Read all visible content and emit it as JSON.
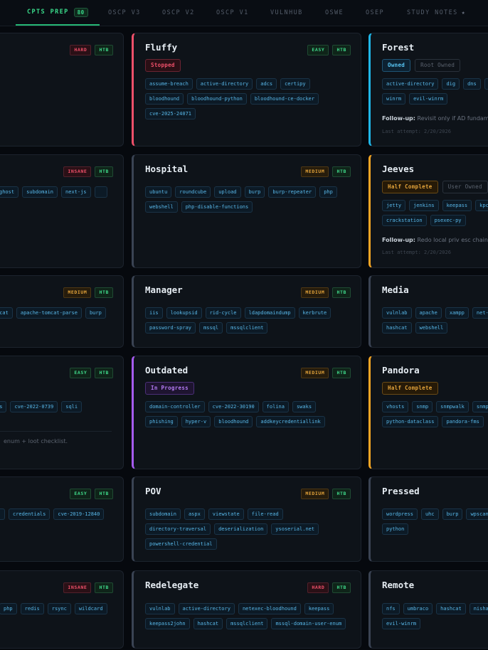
{
  "tabs": [
    {
      "label": "CPTS PREP",
      "count": "80",
      "active": true
    },
    {
      "label": "OSCP V3"
    },
    {
      "label": "OSCP V2"
    },
    {
      "label": "OSCP V1"
    },
    {
      "label": "VULNHUB"
    },
    {
      "label": "OSWE"
    },
    {
      "label": "OSEP"
    },
    {
      "label": "STUDY NOTES",
      "icon": "star-icon",
      "icon_glyph": "★"
    }
  ],
  "colors": {
    "accent_green": "#39d98a",
    "stopped_red": "#f0506a",
    "owned_blue": "#1fb6e8",
    "half_orange": "#f5a524",
    "progress_purple": "#a65bf0",
    "default_gray": "#3a4353"
  },
  "cards": {
    "r1c0": {
      "difficulty": "HARD",
      "platform": "HTB"
    },
    "r1c1": {
      "name": "Fluffy",
      "difficulty": "EASY",
      "platform": "HTB",
      "status": [
        "Stopped"
      ],
      "tags": [
        "assume-breach",
        "active-directory",
        "adcs",
        "certipy",
        "bloodhound",
        "bloodhound-python",
        "bloodhound-ce-docker",
        "cve-2025-24071"
      ]
    },
    "r1c2": {
      "name": "Forest",
      "status": [
        "Owned",
        "Root Owned"
      ],
      "tags": [
        "active-directory",
        "dig",
        "dns",
        "r",
        "winrm",
        "evil-winrm"
      ],
      "followup_label": "Follow-up:",
      "followup": "Revisit only if AD fundame",
      "last_attempt": "Last attempt: 2/20/2026"
    },
    "r2c0": {
      "difficulty": "INSANE",
      "platform": "HTB",
      "tags": [
        "ghost",
        "subdomain",
        "next-js",
        ""
      ]
    },
    "r2c1": {
      "name": "Hospital",
      "difficulty": "MEDIUM",
      "platform": "HTB",
      "tags": [
        "ubuntu",
        "roundcube",
        "upload",
        "burp",
        "burp-repeater",
        "php",
        "webshell",
        "php-disable-functions"
      ]
    },
    "r2c2": {
      "name": "Jeeves",
      "status": [
        "Half Complete",
        "User Owned"
      ],
      "tags": [
        "jetty",
        "jenkins",
        "keepass",
        "kpcl",
        "crackstation",
        "psexec-py"
      ],
      "followup_label": "Follow-up:",
      "followup": "Redo local priv esc chain s",
      "last_attempt": "Last attempt: 2/20/2026"
    },
    "r3c0": {
      "difficulty": "MEDIUM",
      "platform": "HTB",
      "tags": [
        "mcat",
        "apache-tomcat-parse",
        "burp"
      ]
    },
    "r3c1": {
      "name": "Manager",
      "difficulty": "MEDIUM",
      "platform": "HTB",
      "tags": [
        "iis",
        "lookupsid",
        "rid-cycle",
        "ldapdomaindump",
        "kerbrute",
        "password-spray",
        "mssql",
        "mssqlclient"
      ]
    },
    "r3c2": {
      "name": "Media",
      "tags": [
        "vulnlab",
        "apache",
        "xampp",
        "net-",
        "hashcat",
        "webshell"
      ]
    },
    "r4c0": {
      "difficulty": "EASY",
      "platform": "HTB",
      "tags": [
        "ss",
        "cve-2022-0739",
        "sqli"
      ],
      "note": "enum + loot checklist."
    },
    "r4c1": {
      "name": "Outdated",
      "difficulty": "MEDIUM",
      "platform": "HTB",
      "status": [
        "In Progress"
      ],
      "tags": [
        "domain-controller",
        "cve-2022-30190",
        "folina",
        "swaks",
        "phishing",
        "hyper-v",
        "bloodhound",
        "addkeycredentiallink"
      ]
    },
    "r4c2": {
      "name": "Pandora",
      "status": [
        "Half Complete"
      ],
      "tags": [
        "vhosts",
        "snmp",
        "snmpwalk",
        "snmpb",
        "python-dataclass",
        "pandora-fms"
      ]
    },
    "r5c0": {
      "difficulty": "EASY",
      "platform": "HTB",
      "tags": [
        "",
        "credentials",
        "cve-2019-12840"
      ]
    },
    "r5c1": {
      "name": "POV",
      "difficulty": "MEDIUM",
      "platform": "HTB",
      "tags": [
        "subdomain",
        "aspx",
        "viewstate",
        "file-read",
        "directory-traversal",
        "deserialization",
        "ysoserial.net",
        "powershell-credential"
      ]
    },
    "r5c2": {
      "name": "Pressed",
      "tags": [
        "wordpress",
        "uhc",
        "burp",
        "wpscan",
        "python"
      ]
    },
    "r6c0": {
      "difficulty": "INSANE",
      "platform": "HTB",
      "tags": [
        "php",
        "redis",
        "rsync",
        "wildcard"
      ]
    },
    "r6c1": {
      "name": "Redelegate",
      "difficulty": "HARD",
      "platform": "HTB",
      "tags": [
        "vulnlab",
        "active-directory",
        "netexec-bloodhound",
        "keepass",
        "keepass2john",
        "hashcat",
        "mssqlclient",
        "mssql-domain-user-enum"
      ]
    },
    "r6c2": {
      "name": "Remote",
      "tags": [
        "nfs",
        "umbraco",
        "hashcat",
        "nishan",
        "evil-winrm"
      ]
    }
  }
}
